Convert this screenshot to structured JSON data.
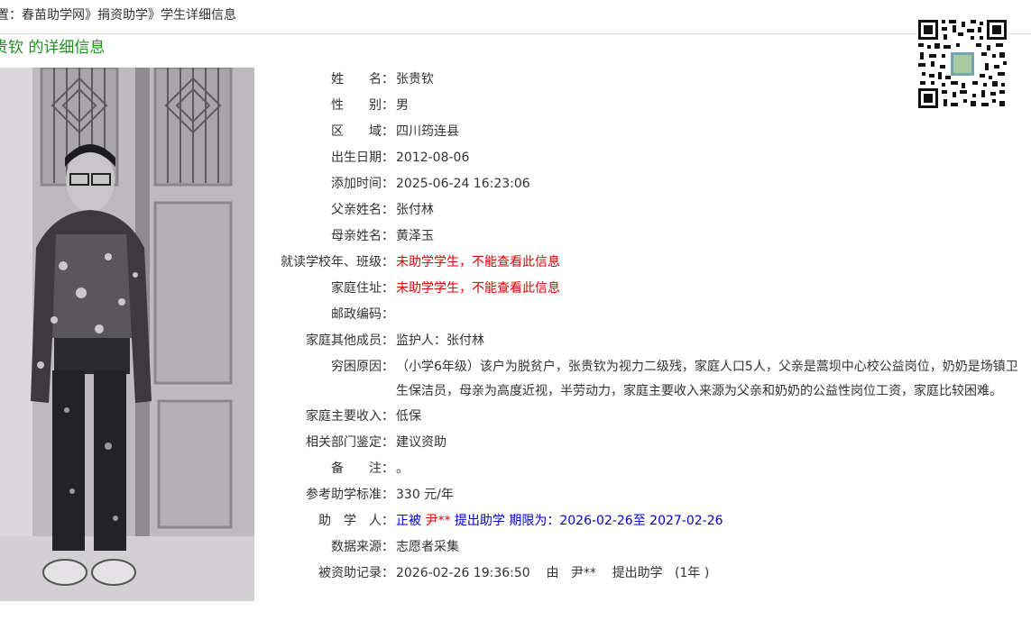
{
  "breadcrumb": {
    "prefix": "置：",
    "site": "春苗助学网",
    "sep1": "》",
    "section": "捐资助学",
    "sep2": "》",
    "page": "学生详细信息"
  },
  "title": "贵钦 的详细信息",
  "photo_alt": "学生照片",
  "qr_icon": "qr-code-icon",
  "fields": {
    "name": {
      "label": "姓　　名：",
      "value": "张贵钦"
    },
    "gender": {
      "label": "性　　别：",
      "value": "男"
    },
    "region": {
      "label": "区　　域：",
      "value": "四川筠连县"
    },
    "birth": {
      "label": "出生日期：",
      "value": "2012-08-06"
    },
    "added": {
      "label": "添加时间：",
      "value": "2025-06-24 16:23:06"
    },
    "father": {
      "label": "父亲姓名：",
      "value": "张付林"
    },
    "mother": {
      "label": "母亲姓名：",
      "value": "黄泽玉"
    },
    "school": {
      "label": "就读学校年、班级：",
      "value": "未助学学生，不能查看此信息"
    },
    "address": {
      "label": "家庭住址：",
      "value": "未助学学生，不能查看此信息"
    },
    "postcode": {
      "label": "邮政编码：",
      "value": ""
    },
    "members": {
      "label": "家庭其他成员：",
      "value": "监护人：张付林"
    },
    "reason": {
      "label": "穷困原因：",
      "value": "（小学6年级）该户为脱贫户，张贵钦为视力二级残，家庭人口5人，父亲是蒿坝中心校公益岗位，奶奶是场镇卫生保洁员，母亲为高度近视，半劳动力，家庭主要收入来源为父亲和奶奶的公益性岗位工资，家庭比较困难。"
    },
    "income": {
      "label": "家庭主要收入：",
      "value": "低保"
    },
    "appraisal": {
      "label": "相关部门鉴定：",
      "value": "建议资助"
    },
    "remark": {
      "label": "备　　注：",
      "value": "。"
    },
    "standard": {
      "label": "参考助学标准：",
      "value": "330 元/年"
    },
    "sponsor": {
      "label": "助　学　人：",
      "prefix": "正被",
      "donor": "尹**",
      "suffix": "提出助学 期限为：2026-02-26至 2027-02-26"
    },
    "source": {
      "label": "数据来源：",
      "value": "志愿者采集"
    },
    "record": {
      "label": "被资助记录：",
      "time": "2026-02-26 19:36:50",
      "by": "由",
      "donor": "尹**",
      "action": "提出助学",
      "duration": "(1年 )"
    }
  },
  "colors": {
    "title": "#1f8f1f",
    "restricted": "#e60000",
    "sponsor": "#0000cc",
    "divider": "#d8d8d8"
  }
}
